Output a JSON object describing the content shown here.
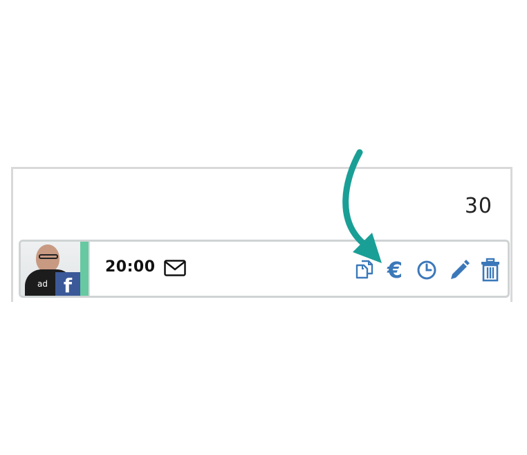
{
  "calendar": {
    "day_number": "30"
  },
  "post": {
    "time": "20:00",
    "avatar_shirt_text": "ad",
    "network_badge": "f",
    "status_color": "#67c9a1",
    "network_color": "#3b5998"
  },
  "actions": {
    "euro_label": "€",
    "icons": [
      "copy-icon",
      "euro-icon",
      "clock-icon",
      "pencil-icon",
      "trash-icon"
    ],
    "icon_color": "#3b78b9"
  },
  "annotation": {
    "arrow_color": "#1a9f96",
    "points_to": "euro-icon"
  }
}
